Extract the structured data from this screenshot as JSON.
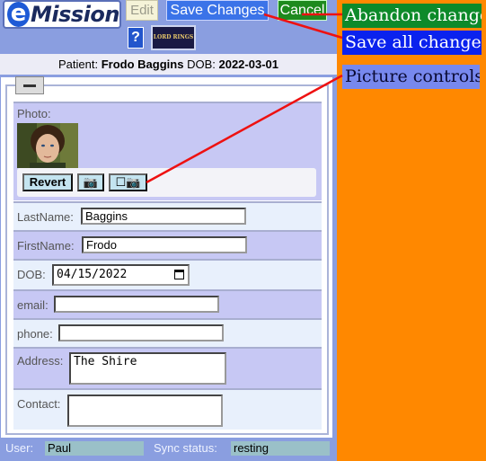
{
  "app": {
    "logo_text": "Mission",
    "toolbar": {
      "edit_label": "Edit",
      "save_label": "Save Changes",
      "cancel_label": "Cancel",
      "help_label": "?",
      "book_label": "LORD RINGS"
    }
  },
  "patient": {
    "prefix": "Patient:",
    "name": "Frodo Baggins",
    "dob_label": "DOB:",
    "dob": "2022-03-01"
  },
  "form": {
    "photo_label": "Photo:",
    "revert_label": "Revert",
    "camera_icon": "📷",
    "upload_icon": "☐📷",
    "lastname_label": "LastName:",
    "lastname_value": "Baggins",
    "firstname_label": "FirstName:",
    "firstname_value": "Frodo",
    "dob_label": "DOB:",
    "dob_value": "04/15/2022",
    "email_label": "email:",
    "email_value": "",
    "phone_label": "phone:",
    "phone_value": "",
    "address_label": "Address:",
    "address_value": "The Shire",
    "contact_label": "Contact:",
    "contact_value": ""
  },
  "status": {
    "user_label": "User:",
    "user_value": "Paul",
    "sync_label": "Sync status:",
    "sync_value": "resting"
  },
  "callouts": {
    "abandon": "Abandon changes",
    "save": "Save all changers",
    "picture": "Picture controls"
  },
  "colors": {
    "background": "#ff8800",
    "app_panel": "#8a9ee0",
    "save_button": "#3b73e8",
    "cancel_button": "#1e8a1e",
    "row_violet": "#c7c8f4",
    "row_pale": "#e8f0fc",
    "arrow": "#ee1111"
  }
}
